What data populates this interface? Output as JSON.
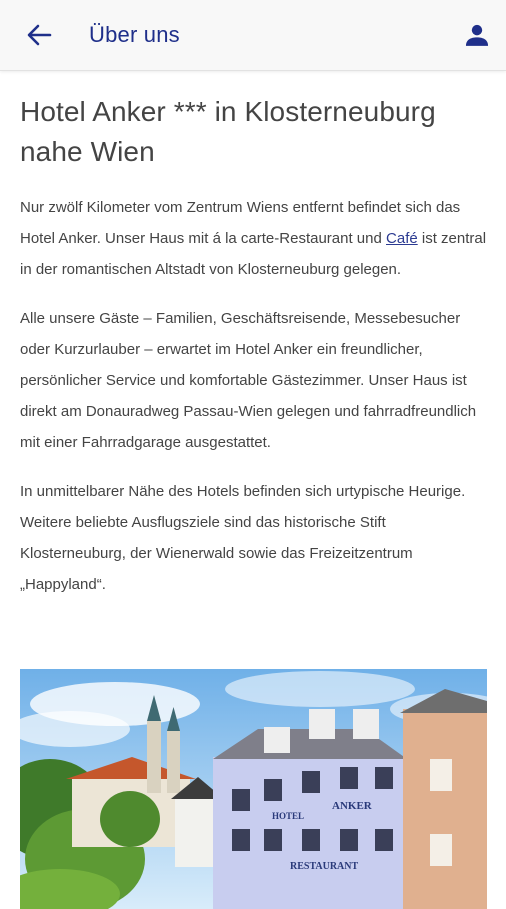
{
  "appbar": {
    "title": "Über uns",
    "back_icon": "arrow-left-icon",
    "profile_icon": "person-icon",
    "accent": "#1f2f8a"
  },
  "main": {
    "heading": "Hotel Anker *** in Klosterneuburg nahe Wien",
    "p1": {
      "before_link": "Nur zwölf Kilometer vom Zentrum Wiens entfernt befindet sich das Hotel Anker. Unser Haus mit á la carte-Restaurant und ",
      "link": "Café",
      "after_link": " ist zentral in der romantischen Altstadt von Klosterneuburg gelegen."
    },
    "p2": "Alle unsere Gäste – Familien, Geschäftsreisende, Messebesucher oder Kurzurlauber – erwartet im Hotel Anker ein freundlicher, persönlicher Service und komfortable Gästezimmer. Unser Haus ist direkt am Donauradweg Passau-Wien gelegen und fahrradfreundlich mit einer Fahrradgarage ausgestattet.",
    "p3": "In unmittelbarer Nähe des Hotels befinden sich urtypische Heurige. Weitere beliebte Ausflugsziele sind das historische Stift Klosterneuburg, der Wienerwald sowie das Freizeitzentrum „Happyland“."
  },
  "hero_image": {
    "sign_hotel": "HOTEL",
    "sign_anker": "ANKER",
    "sign_restaurant": "RESTAURANT"
  }
}
